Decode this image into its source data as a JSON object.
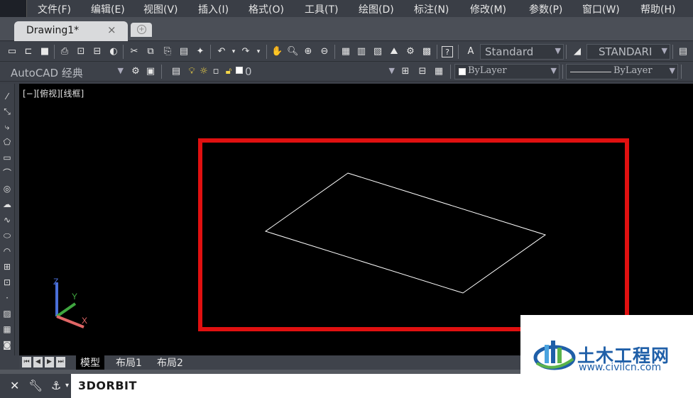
{
  "menu": {
    "items": [
      "文件(F)",
      "编辑(E)",
      "视图(V)",
      "插入(I)",
      "格式(O)",
      "工具(T)",
      "绘图(D)",
      "标注(N)",
      "修改(M)",
      "参数(P)",
      "窗口(W)",
      "帮助(H)"
    ]
  },
  "tabs": {
    "document": "Drawing1*",
    "close_glyph": "×",
    "new_glyph": "+"
  },
  "toolbar": {
    "text_style": "Standard",
    "dim_style": "STANDARI",
    "workspace": "AutoCAD 经典",
    "layer": "0",
    "color": "ByLayer",
    "linetype": "ByLayer"
  },
  "viewport": {
    "label": "[−][俯视][线框]",
    "ucs": {
      "z": "Z",
      "y": "Y",
      "x": "X"
    },
    "highlight_color": "#e01010",
    "line_color": "#ffffff"
  },
  "layout_tabs": [
    "模型",
    "布局1",
    "布局2"
  ],
  "command": {
    "text": "3DORBIT",
    "close_glyph": "✕"
  },
  "watermark": {
    "title": "土木工程网",
    "url": "www.civilcn.com"
  }
}
